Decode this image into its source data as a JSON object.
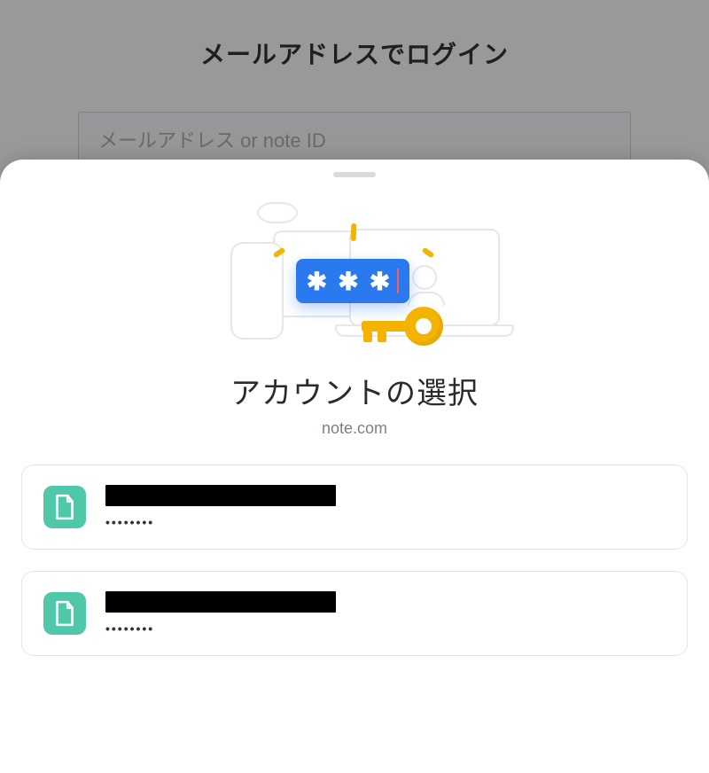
{
  "login": {
    "title": "メールアドレスでログイン",
    "email_placeholder": "メールアドレス or note ID"
  },
  "sheet": {
    "title": "アカウントの選択",
    "domain": "note.com"
  },
  "accounts": [
    {
      "username_redacted": true,
      "password_mask": "••••••••"
    },
    {
      "username_redacted": true,
      "password_mask": "••••••••"
    }
  ],
  "icons": {
    "app": "note-app-icon",
    "key": "key-icon",
    "password_field": "password-asterisks"
  },
  "colors": {
    "accent_blue": "#2a79ee",
    "key_yellow": "#f5b301",
    "app_icon_bg": "#4ec8a8"
  }
}
